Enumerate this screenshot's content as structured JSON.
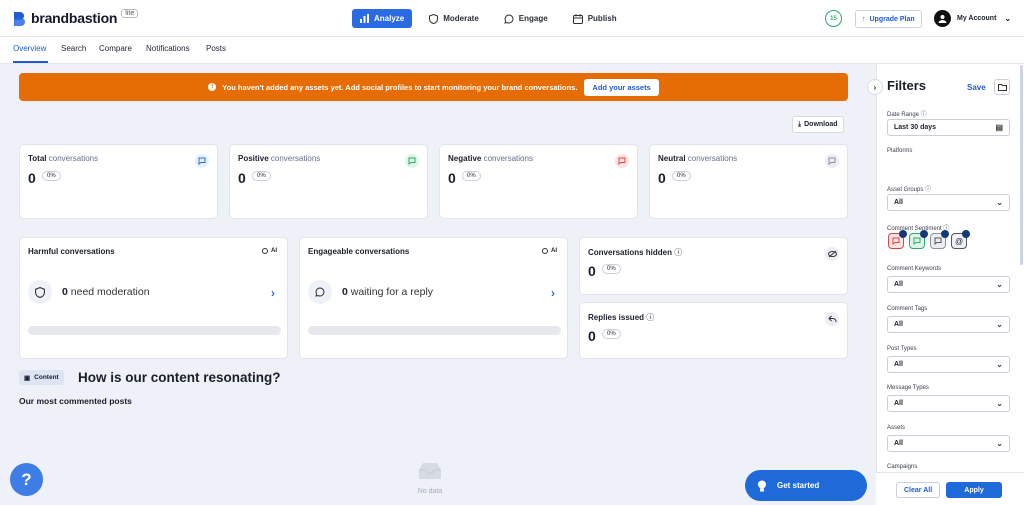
{
  "header": {
    "brand": "brandbastion",
    "badge": "lite",
    "nav": [
      {
        "label": "Analyze",
        "active": true
      },
      {
        "label": "Moderate",
        "active": false
      },
      {
        "label": "Engage",
        "active": false
      },
      {
        "label": "Publish",
        "active": false
      }
    ],
    "credits": "15",
    "upgrade_label": "Upgrade Plan",
    "account_label": "My Account"
  },
  "subnav": {
    "tabs": [
      {
        "label": "Overview",
        "active": true
      },
      {
        "label": "Search",
        "active": false
      },
      {
        "label": "Compare",
        "active": false
      },
      {
        "label": "Notifications",
        "active": false
      },
      {
        "label": "Posts",
        "active": false
      }
    ]
  },
  "banner": {
    "message": "You haven't added any assets yet. Add social profiles to start monitoring your brand conversations.",
    "button": "Add your assets",
    "color": "#e66c05"
  },
  "download_label": "Download",
  "stats": [
    {
      "bold": "Total",
      "rest": " conversations",
      "value": "0",
      "pct": "0%",
      "icon": "chat-bubble-icon",
      "color": "#2a6be3"
    },
    {
      "bold": "Positive",
      "rest": " conversations",
      "value": "0",
      "pct": "0%",
      "icon": "positive-chat-icon",
      "color": "#2ca86a"
    },
    {
      "bold": "Negative",
      "rest": " conversations",
      "value": "0",
      "pct": "0%",
      "icon": "negative-chat-icon",
      "color": "#e04545"
    },
    {
      "bold": "Neutral",
      "rest": " conversations",
      "value": "0",
      "pct": "0%",
      "icon": "neutral-chat-icon",
      "color": "#8a90a0"
    }
  ],
  "harmful": {
    "title": "Harmful conversations",
    "ai": "AI",
    "value": "0",
    "text": " need moderation"
  },
  "engageable": {
    "title": "Engageable conversations",
    "ai": "AI",
    "value": "0",
    "text": " waiting for a reply"
  },
  "hidden": {
    "title": "Conversations hidden",
    "value": "0",
    "pct": "0%"
  },
  "replies": {
    "title": "Replies issued",
    "value": "0",
    "pct": "0%"
  },
  "content": {
    "tag": "Content",
    "title": "How is our content resonating?",
    "subtitle": "Our most commented posts",
    "empty": "No data"
  },
  "help_label": "?",
  "get_started": "Get started",
  "filters": {
    "title": "Filters",
    "save": "Save",
    "date_range_label": "Date Range",
    "date_range_value": "Last 30 days",
    "platforms_label": "Platforms",
    "asset_groups_label": "Asset Groups",
    "asset_groups_value": "All",
    "sentiment_label": "Comment Sentiment",
    "keywords_label": "Comment Keywords",
    "keywords_value": "All",
    "tags_label": "Comment Tags",
    "tags_value": "All",
    "post_types_label": "Post Types",
    "post_types_value": "All",
    "message_types_label": "Message Types",
    "message_types_value": "All",
    "assets_label": "Assets",
    "assets_value": "All",
    "campaigns_label": "Campaigns",
    "clear_all": "Clear All",
    "apply": "Apply"
  }
}
